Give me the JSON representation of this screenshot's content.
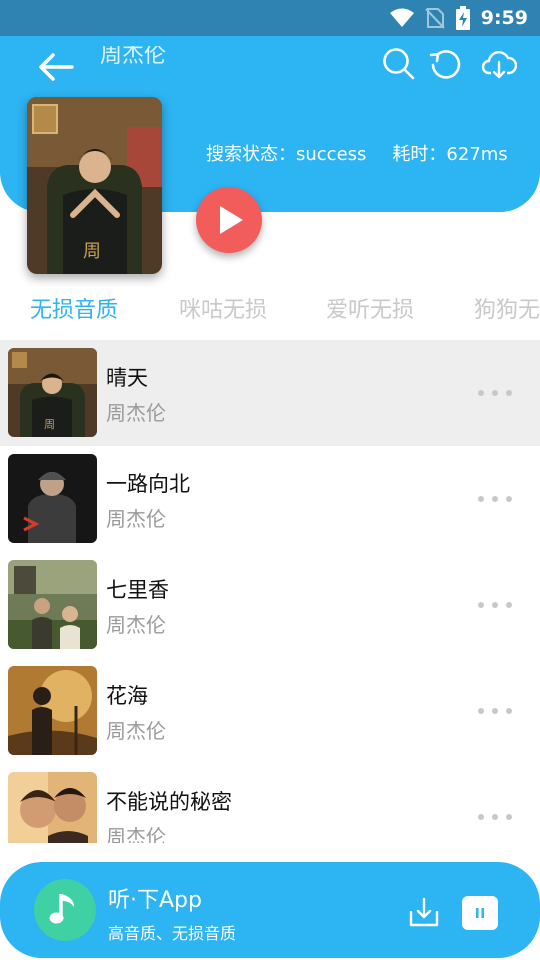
{
  "status_bar": {
    "time": "9:59"
  },
  "header": {
    "title": "周杰伦",
    "search_status": "搜索状态：success",
    "elapsed": "耗时：627ms"
  },
  "tabs": [
    "无损音质",
    "咪咕无损",
    "爱听无损",
    "狗狗无"
  ],
  "active_tab": 0,
  "songs": [
    {
      "title": "晴天",
      "artist": "周杰伦"
    },
    {
      "title": "一路向北",
      "artist": "周杰伦"
    },
    {
      "title": "七里香",
      "artist": "周杰伦"
    },
    {
      "title": "花海",
      "artist": "周杰伦"
    },
    {
      "title": "不能说的秘密",
      "artist": "周杰伦"
    }
  ],
  "player": {
    "app_name": "听·下App",
    "app_desc": "高音质、无损音质"
  },
  "colors": {
    "accent": "#2db4f2",
    "status_bar": "#2e83b3",
    "play_button": "#f25c5b",
    "app_logo": "#3fd0a4"
  }
}
